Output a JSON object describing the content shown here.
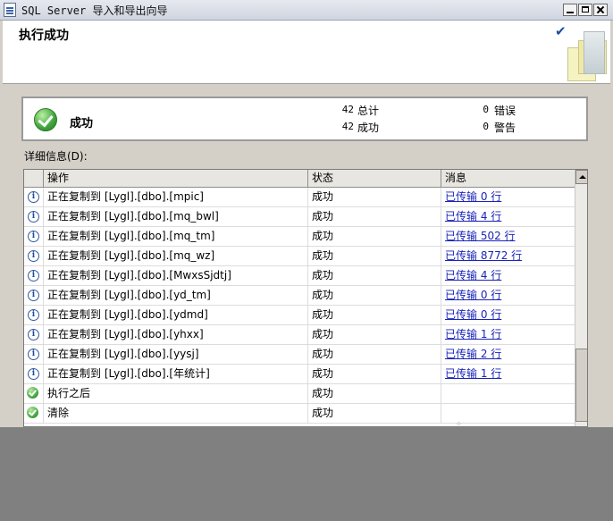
{
  "window": {
    "title": "SQL Server 导入和导出向导"
  },
  "header": {
    "title": "执行成功"
  },
  "summary": {
    "status": "成功",
    "total_count": "42",
    "total_label": "总计",
    "success_count": "42",
    "success_label": "成功",
    "error_count": "0",
    "error_label": "错误",
    "warning_count": "0",
    "warning_label": "警告"
  },
  "details": {
    "label": "详细信息(D):",
    "columns": [
      "操作",
      "状态",
      "消息"
    ],
    "rows": [
      {
        "icon": "info-icon",
        "action": "正在复制到 [Lygl].[dbo].[mpic]",
        "status": "成功",
        "message": "已传输 0 行"
      },
      {
        "icon": "info-icon",
        "action": "正在复制到 [Lygl].[dbo].[mq_bwl]",
        "status": "成功",
        "message": "已传输 4 行"
      },
      {
        "icon": "info-icon",
        "action": "正在复制到 [Lygl].[dbo].[mq_tm]",
        "status": "成功",
        "message": "已传输 502 行"
      },
      {
        "icon": "info-icon",
        "action": "正在复制到 [Lygl].[dbo].[mq_wz]",
        "status": "成功",
        "message": "已传输 8772 行"
      },
      {
        "icon": "info-icon",
        "action": "正在复制到 [Lygl].[dbo].[MwxsSjdtj]",
        "status": "成功",
        "message": "已传输 4 行"
      },
      {
        "icon": "info-icon",
        "action": "正在复制到 [Lygl].[dbo].[yd_tm]",
        "status": "成功",
        "message": "已传输 0 行"
      },
      {
        "icon": "info-icon",
        "action": "正在复制到 [Lygl].[dbo].[ydmd]",
        "status": "成功",
        "message": "已传输 0 行"
      },
      {
        "icon": "info-icon",
        "action": "正在复制到 [Lygl].[dbo].[yhxx]",
        "status": "成功",
        "message": "已传输 1 行"
      },
      {
        "icon": "info-icon",
        "action": "正在复制到 [Lygl].[dbo].[yysj]",
        "status": "成功",
        "message": "已传输 2 行"
      },
      {
        "icon": "info-icon",
        "action": "正在复制到 [Lygl].[dbo].[年统计]",
        "status": "成功",
        "message": "已传输 1 行"
      },
      {
        "icon": "success-icon",
        "action": "执行之后",
        "status": "成功",
        "message": ""
      },
      {
        "icon": "success-icon",
        "action": "清除",
        "status": "成功",
        "message": ""
      }
    ]
  }
}
